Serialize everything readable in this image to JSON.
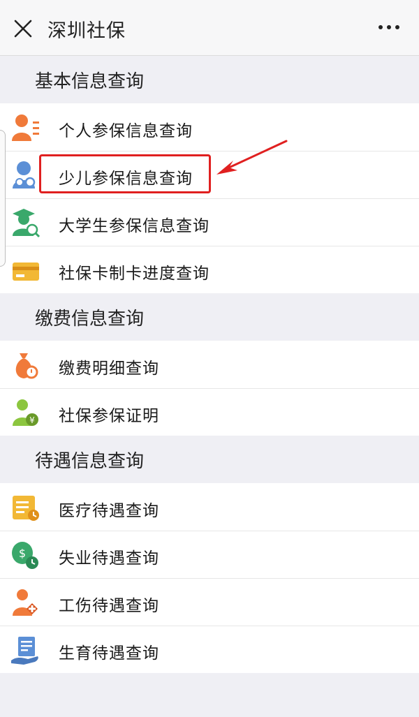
{
  "window": {
    "title": "深圳社保",
    "close_icon": "close-icon",
    "more_icon": "more-dots-icon"
  },
  "sections": [
    {
      "title": "基本信息查询",
      "items": [
        {
          "label": "个人参保信息查询",
          "icon": "person-info-icon",
          "color": "#f07a3a"
        },
        {
          "label": "少儿参保信息查询",
          "icon": "child-insurance-icon",
          "color": "#5b8fd6"
        },
        {
          "label": "大学生参保信息查询",
          "icon": "graduate-icon",
          "color": "#3aa86b"
        },
        {
          "label": "社保卡制卡进度查询",
          "icon": "card-icon",
          "color": "#f2b835"
        }
      ]
    },
    {
      "title": "缴费信息查询",
      "items": [
        {
          "label": "缴费明细查询",
          "icon": "money-bag-icon",
          "color": "#f07a3a"
        },
        {
          "label": "社保参保证明",
          "icon": "certificate-person-icon",
          "color": "#8cc63f"
        }
      ]
    },
    {
      "title": "待遇信息查询",
      "items": [
        {
          "label": "医疗待遇查询",
          "icon": "calendar-clock-icon",
          "color": "#f2b835"
        },
        {
          "label": "失业待遇查询",
          "icon": "coin-clock-icon",
          "color": "#3aa86b"
        },
        {
          "label": "工伤待遇查询",
          "icon": "injury-icon",
          "color": "#f07a3a"
        },
        {
          "label": "生育待遇查询",
          "icon": "document-hand-icon",
          "color": "#5b8fd6"
        }
      ]
    }
  ],
  "annotation": {
    "highlight_color": "#e02020"
  }
}
